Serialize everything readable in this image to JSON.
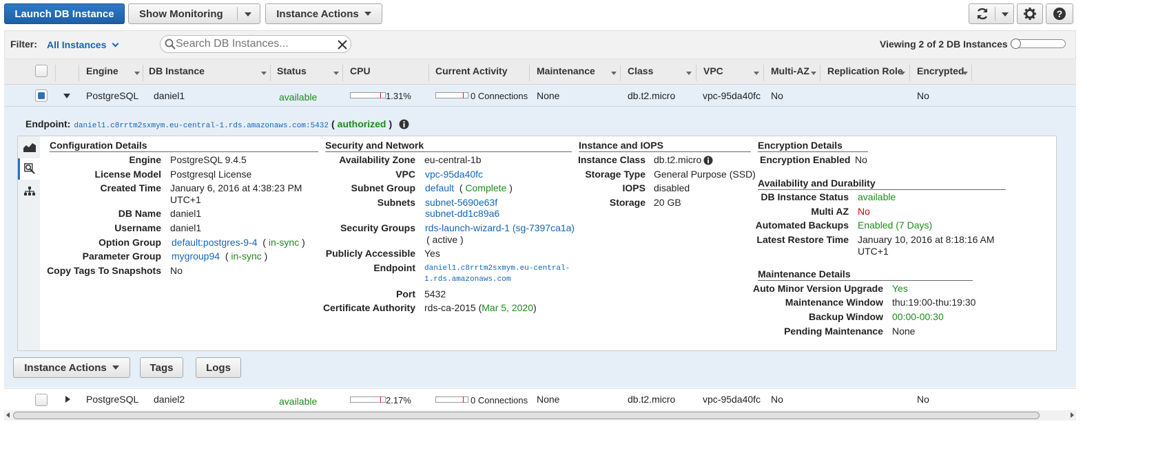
{
  "toolbar": {
    "launch": "Launch DB Instance",
    "monitoring": "Show Monitoring",
    "instance_actions": "Instance Actions"
  },
  "filterbar": {
    "filter_label": "Filter:",
    "filter_value": "All Instances",
    "search_placeholder": "Search DB Instances...",
    "viewing": "Viewing 2 of 2 DB Instances"
  },
  "columns": [
    "Engine",
    "DB Instance",
    "Status",
    "CPU",
    "Current Activity",
    "Maintenance",
    "Class",
    "VPC",
    "Multi-AZ",
    "Replication Role",
    "Encrypted"
  ],
  "rows": [
    {
      "engine": "PostgreSQL",
      "instance": "daniel1",
      "status": "available",
      "cpu": "1.31%",
      "activity": "0 Connections",
      "maintenance": "None",
      "class": "db.t2.micro",
      "vpc": "vpc-95da40fc",
      "multiaz": "No",
      "encrypted": "No"
    },
    {
      "engine": "PostgreSQL",
      "instance": "daniel2",
      "status": "available",
      "cpu": "2.17%",
      "activity": "0 Connections",
      "maintenance": "None",
      "class": "db.t2.micro",
      "vpc": "vpc-95da40fc",
      "multiaz": "No",
      "encrypted": "No"
    }
  ],
  "endpoint": {
    "label": "Endpoint:",
    "value": "daniel1.c8rrtm2sxmym.eu-central-1.rds.amazonaws.com:5432",
    "paren_open": "(",
    "status": "authorized",
    "paren_close": ")"
  },
  "config": {
    "title": "Configuration Details",
    "engine_l": "Engine",
    "engine": "PostgreSQL 9.4.5",
    "license_l": "License Model",
    "license": "Postgresql License",
    "created_l": "Created Time",
    "created1": "January 6, 2016 at 4:38:23 PM",
    "created2": "UTC+1",
    "dbname_l": "DB Name",
    "dbname": "daniel1",
    "username_l": "Username",
    "username": "daniel1",
    "option_l": "Option Group",
    "option": "default:postgres-9-4",
    "option_s": "in-sync",
    "param_l": "Parameter Group",
    "param": "mygroup94",
    "param_s": "in-sync",
    "copy_l": "Copy Tags To Snapshots",
    "copy": "No"
  },
  "security": {
    "title": "Security and Network",
    "az_l": "Availability Zone",
    "az": "eu-central-1b",
    "vpc_l": "VPC",
    "vpc": "vpc-95da40fc",
    "subnetg_l": "Subnet Group",
    "subnetg": "default",
    "subnetg_s": "Complete",
    "subnets_l": "Subnets",
    "subnet1": "subnet-5690e63f",
    "subnet2": "subnet-dd1c89a6",
    "sg_l": "Security Groups",
    "sg": "rds-launch-wizard-1 (sg-7397ca1a)",
    "sg_s": "( active )",
    "public_l": "Publicly Accessible",
    "public": "Yes",
    "endpoint_l": "Endpoint",
    "endpoint1": "daniel1.c8rrtm2sxmym.eu-central-",
    "endpoint2": "1.rds.amazonaws.com",
    "port_l": "Port",
    "port": "5432",
    "ca_l": "Certificate Authority",
    "ca": "rds-ca-2015 (",
    "ca_date": "Mar 5, 2020",
    "ca_close": ")"
  },
  "iops": {
    "title": "Instance and IOPS",
    "class_l": "Instance Class",
    "class": "db.t2.micro",
    "storage_type_l": "Storage Type",
    "storage_type": "General Purpose (SSD)",
    "iops_l": "IOPS",
    "iops": "disabled",
    "storage_l": "Storage",
    "storage": "20 GB"
  },
  "encryption": {
    "title": "Encryption Details",
    "enabled_l": "Encryption Enabled",
    "enabled": "No"
  },
  "availability": {
    "title": "Availability and Durability",
    "status_l": "DB Instance Status",
    "status": "available",
    "multiaz_l": "Multi AZ",
    "multiaz": "No",
    "backups_l": "Automated Backups",
    "backups": "Enabled (7 Days)",
    "restore_l": "Latest Restore Time",
    "restore1": "January 10, 2016 at 8:18:16 AM",
    "restore2": "UTC+1"
  },
  "maintenance": {
    "title": "Maintenance Details",
    "auto_l": "Auto Minor Version Upgrade",
    "auto": "Yes",
    "window_l": "Maintenance Window",
    "window": "thu:19:00-thu:19:30",
    "backup_l": "Backup Window",
    "backup": "00:00-00:30",
    "pending_l": "Pending Maintenance",
    "pending": "None"
  },
  "detail_actions": {
    "instance_actions": "Instance Actions",
    "tags": "Tags",
    "logs": "Logs"
  },
  "colors": {
    "primary": "#1c5fa5",
    "link": "#1166bb",
    "green": "#1d8a1d",
    "red": "#d40000",
    "selected_row": "#e6eef7"
  }
}
